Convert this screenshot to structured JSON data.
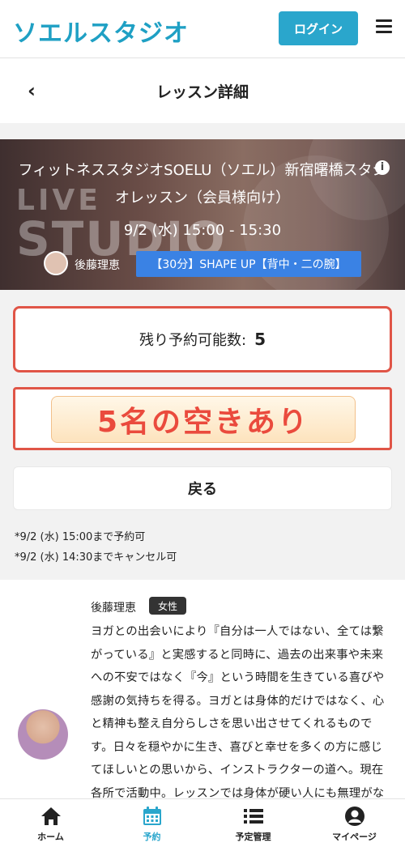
{
  "header": {
    "logo": "ソエルスタジオ",
    "login_label": "ログイン"
  },
  "titlebar": {
    "title": "レッスン詳細"
  },
  "lesson": {
    "title": "フィットネススタジオSOELU（ソエル）新宿曙橋スタジオレッスン（会員様向け）",
    "datetime": "9/2 (水) 15:00 - 15:30",
    "instructor": "後藤理恵",
    "tag": "【30分】SHAPE UP【背中・二の腕】",
    "bg_text_1": "LIVE",
    "bg_text_2": "STUDIO"
  },
  "availability": {
    "label": "残り予約可能数:",
    "count": "5",
    "badge": "5名の空きあり"
  },
  "back_button": "戻る",
  "notes": [
    "*9/2 (水) 15:00まで予約可",
    "*9/2 (水) 14:30までキャンセル可"
  ],
  "bio": {
    "name": "後藤理恵",
    "gender": "女性",
    "text": "ヨガとの出会いにより『自分は一人ではない、全ては繋がっている』と実感すると同時に、過去の出来事や未来への不安ではなく『今』という時間を生きている喜びや感謝の気持ちを得る。ヨガとは身体的だけではなく、心と精神も整え自分らしさを思い出させてくれるものです。日々を穏やかに生き、喜びと幸せを多くの方に感じてほしいとの思いから、インストラクターの道へ。現在各所で活動中。レッスンでは身体が硬い人にも無理がなく、安心して楽しんで頂けよう心がけ、少しでも心や身"
  },
  "tabs": [
    {
      "label": "ホーム",
      "icon": "home-icon",
      "active": false
    },
    {
      "label": "予約",
      "icon": "calendar-icon",
      "active": true
    },
    {
      "label": "予定管理",
      "icon": "list-icon",
      "active": false
    },
    {
      "label": "マイページ",
      "icon": "user-icon",
      "active": false
    }
  ],
  "colors": {
    "brand": "#1fa0c4",
    "accent_button": "#2aa6cc",
    "highlight_border": "#e05547",
    "badge_text": "#ea4a3d",
    "tag_bg": "#3a82e4"
  }
}
